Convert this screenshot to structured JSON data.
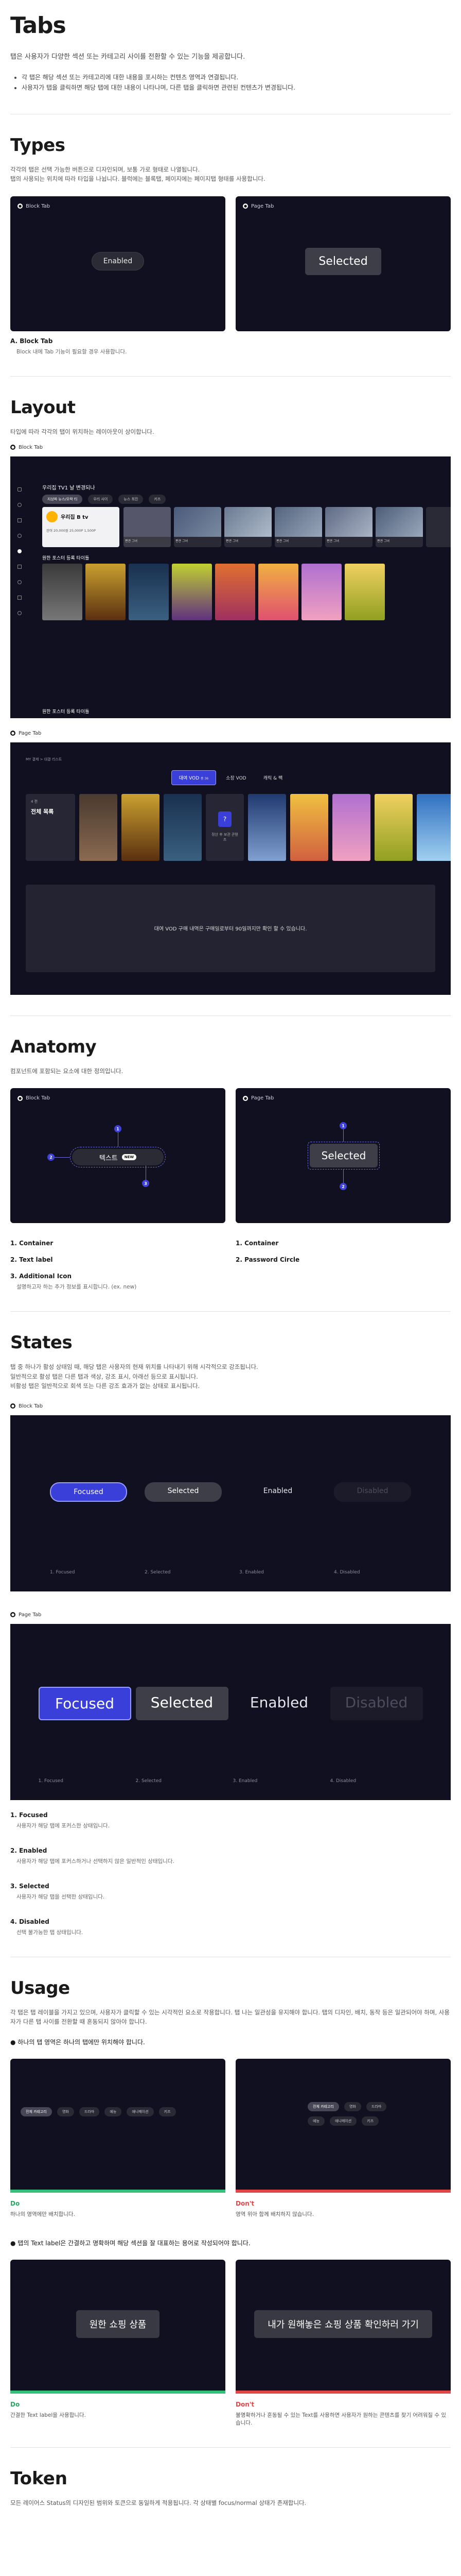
{
  "header": {
    "title": "Tabs",
    "lead": "탭은 사용자가 다양한 섹션 또는 카테고리 사이를 전환할 수 있는 기능을 제공합니다.",
    "bullets": [
      "각 탭은 해당 섹션 또는 카테고리에 대한 내용을 포시하는 컨텐츠 영역과 연결됩니다.",
      "사용자가 탭을 클릭하면 해당 탭에 대한 내용이 나타나며, 다른 탭을 클릭하면 관련된 컨텐츠가 변경됩니다."
    ]
  },
  "types": {
    "heading": "Types",
    "desc1": "각각의 탭은 선택 가능한 버튼으로 디자인되며, 보통 가로 형태로 나열됩니다.",
    "desc2": "탭의 사용되는 위치에 따라 타입을 나뉩니다. 블럭에는 블록탭, 페이지에는 페이지탭 형태를 사용합니다.",
    "block_label": "Block Tab",
    "page_label": "Page Tab",
    "block_tab_text": "Enabled",
    "page_tab_text": "Selected",
    "caption_title": "A. Block Tab",
    "caption_sub": "Block 내에 Tab 기능이 필요할 경우 사용합니다."
  },
  "layout": {
    "heading": "Layout",
    "desc": "타입에 따라 각각의 탭이 위치하는 레이아웃이 상이합니다.",
    "block_label": "Block Tab",
    "page_label": "Page Tab",
    "block_screen": {
      "row_title": "우리집 TV1 날 변경되나",
      "tabs": [
        "지상파 뉴스/오락 티",
        "우리 사이",
        "뉴스 최진",
        "키즈"
      ],
      "profile_name": "우리집 B tv",
      "profile_sub": "잔여 20,000원  25,000P  1,500P",
      "poster_caption": "편견 그녀",
      "recommend_title": "원한 포스터 등록 타이틀",
      "bottom_title": "원한 포스터 등록 타이틀"
    },
    "page_screen": {
      "breadcrumb": "MY 결제 > 대결 리스트",
      "tabs": [
        "대여 VOD",
        "소장 VOD",
        "캐릭 & 팩"
      ],
      "tab_count": "총 36",
      "side_title": "전체 목록",
      "side_sub": "4 편",
      "help_text": "정산 후 보관 콘텐츠",
      "message": "대여 VOD 구매 내역은 구매일로부터 90일까지만 확인 할 수 있습니다."
    }
  },
  "anatomy": {
    "heading": "Anatomy",
    "desc": "컴포넌트에 포함되는 요소에 대한 정의입니다.",
    "block_label": "Block Tab",
    "page_label": "Page Tab",
    "block_tab_text": "텍스트",
    "block_badge": "NEW",
    "page_tab_text": "Selected",
    "left_items": [
      {
        "num": "1.",
        "title": "Container",
        "sub": ""
      },
      {
        "num": "2.",
        "title": "Text label",
        "sub": ""
      },
      {
        "num": "3.",
        "title": "Additional Icon",
        "sub": "설명하고자 하는 추가 정보를 표시합니다. (ex. new)"
      }
    ],
    "right_items": [
      {
        "num": "1.",
        "title": "Container"
      },
      {
        "num": "2.",
        "title": "Password Circle"
      }
    ],
    "markers": [
      "1",
      "2",
      "3"
    ]
  },
  "states": {
    "heading": "States",
    "desc1": "탭 중 하나가 활성 상태임 때, 해당 탭은 사용자의 현재 위치를 나타내기 위해 시각적으로 강조됩니다.",
    "desc2": "일반적으로 활성 탭은 다른 탭과 색상, 강조 표시, 아래선 등으로 표시됩니다.",
    "desc3": "비활성 탭은 일반적으로 회색 또는 다른 강조 효과가 없는 상태로 표시됩니다.",
    "block_label": "Block Tab",
    "page_label": "Page Tab",
    "tabs": [
      "Focused",
      "Selected",
      "Enabled",
      "Disabled"
    ],
    "captions": [
      "1. Focused",
      "2. Selected",
      "3. Enabled",
      "4. Disabled"
    ],
    "list": [
      {
        "title": "1. Focused",
        "sub": "사용자가 해당 탭에 포커스한 상태입니다."
      },
      {
        "title": "2. Enabled",
        "sub": "사용자가 해당 탭에 포커스하거나 선택하지 않은 일반적인 상태입니다."
      },
      {
        "title": "3. Selected",
        "sub": "사용자가 해당 탭을 선택한 상태입니다."
      },
      {
        "title": "4. Disabled",
        "sub": "선택 불가능한 탭 상태입니다."
      }
    ]
  },
  "usage": {
    "heading": "Usage",
    "desc1": "각 탭은 탭 레이블을 가지고 있으며, 사용자가 클릭할 수 있는 시각적인 요소로 작용합니다. 탭 나는 일관성을 유지해야 합니다. 탭의 디자인, 배치, 동작 등은 일관되어야 하며, 사용자가 다른 탭 사이를 전환할 때 혼동되지 않아야 합니다.",
    "check1": "하나의 탭 영역은 하나의 탭에만 위치해야 합니다.",
    "do": "Do",
    "dont": "Don't",
    "do_sub1": "하나의 영역에만 배치합니다.",
    "dont_sub1": "영역 위아 함께 배치하지 않습니다.",
    "chips": [
      "전체 카테고리",
      "영화",
      "드라마",
      "예능",
      "애니메이션",
      "키즈"
    ],
    "check2": "탭의 Text label은 간결하고 명확하며 해당 섹션을 잘 대표하는 용어로 작성되어야 합니다.",
    "do_button": "원한 쇼핑 상품",
    "dont_button": "내가 원해놓은 쇼핑 상품 확인하러 가기",
    "do_sub2": "간결한 Text label을 사용합니다.",
    "dont_sub2": "불명확하거나 혼동될 수 있는 Text를 사용하면 사용자가 원하는 콘텐츠를 찾기 어려워질 수 있습니다."
  },
  "token": {
    "heading": "Token",
    "desc": "모든 레이어스 Status의 디자인된 범위와 토큰으로 동일하게 적용됩니다. 각 상태별 focus/normal 상태가 존재합니다."
  },
  "colors": {
    "dark": "#111020",
    "focused": "#3a3fd9",
    "do": "#35c07a",
    "dont": "#e04646"
  }
}
